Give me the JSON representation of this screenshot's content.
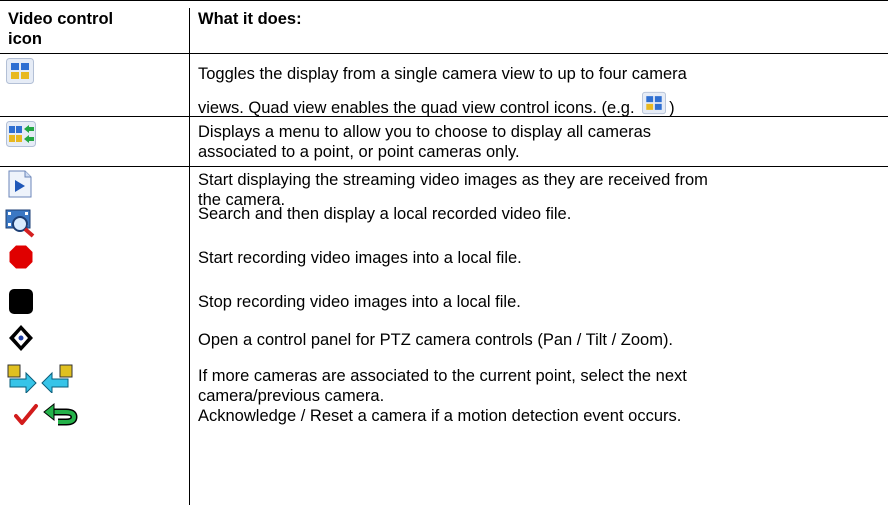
{
  "table": {
    "header": {
      "col1": "Video control icon",
      "col1_line1": "Video control",
      "col1_line2": "icon",
      "col2": "What it does:"
    },
    "rows": [
      {
        "icon": "quad-view-icon",
        "line1": "Toggles the display from a single camera view to up to four camera",
        "line2_before": "views. Quad view enables the quad view control icons. (e.g.",
        "line2_after": ")"
      },
      {
        "icon": "camera-menu-icon",
        "line1": "Displays a menu to allow you to choose to display all cameras",
        "line2": "associated to a point, or point cameras only."
      },
      {
        "icon": "play-stream-icon",
        "line1": "Start displaying the streaming video images as they are received from",
        "line2": "the camera."
      },
      {
        "icon": "search-recorded-video-icon",
        "line1": "Search and then display a local recorded video file."
      },
      {
        "icon": "record-icon",
        "line1": "Start recording video images into a local file."
      },
      {
        "icon": "stop-icon",
        "line1": "Stop recording video images into a local file."
      },
      {
        "icon": "ptz-control-icon",
        "line1": "Open a control panel for PTZ camera controls (Pan / Tilt / Zoom)."
      },
      {
        "icon": "next-previous-camera-icon",
        "line1": "If more cameras are associated to the current point, select the next",
        "line2": "camera/previous camera."
      },
      {
        "icon": "acknowledge-reset-icon",
        "line1": "Acknowledge / Reset a camera if a motion detection event occurs."
      }
    ]
  }
}
